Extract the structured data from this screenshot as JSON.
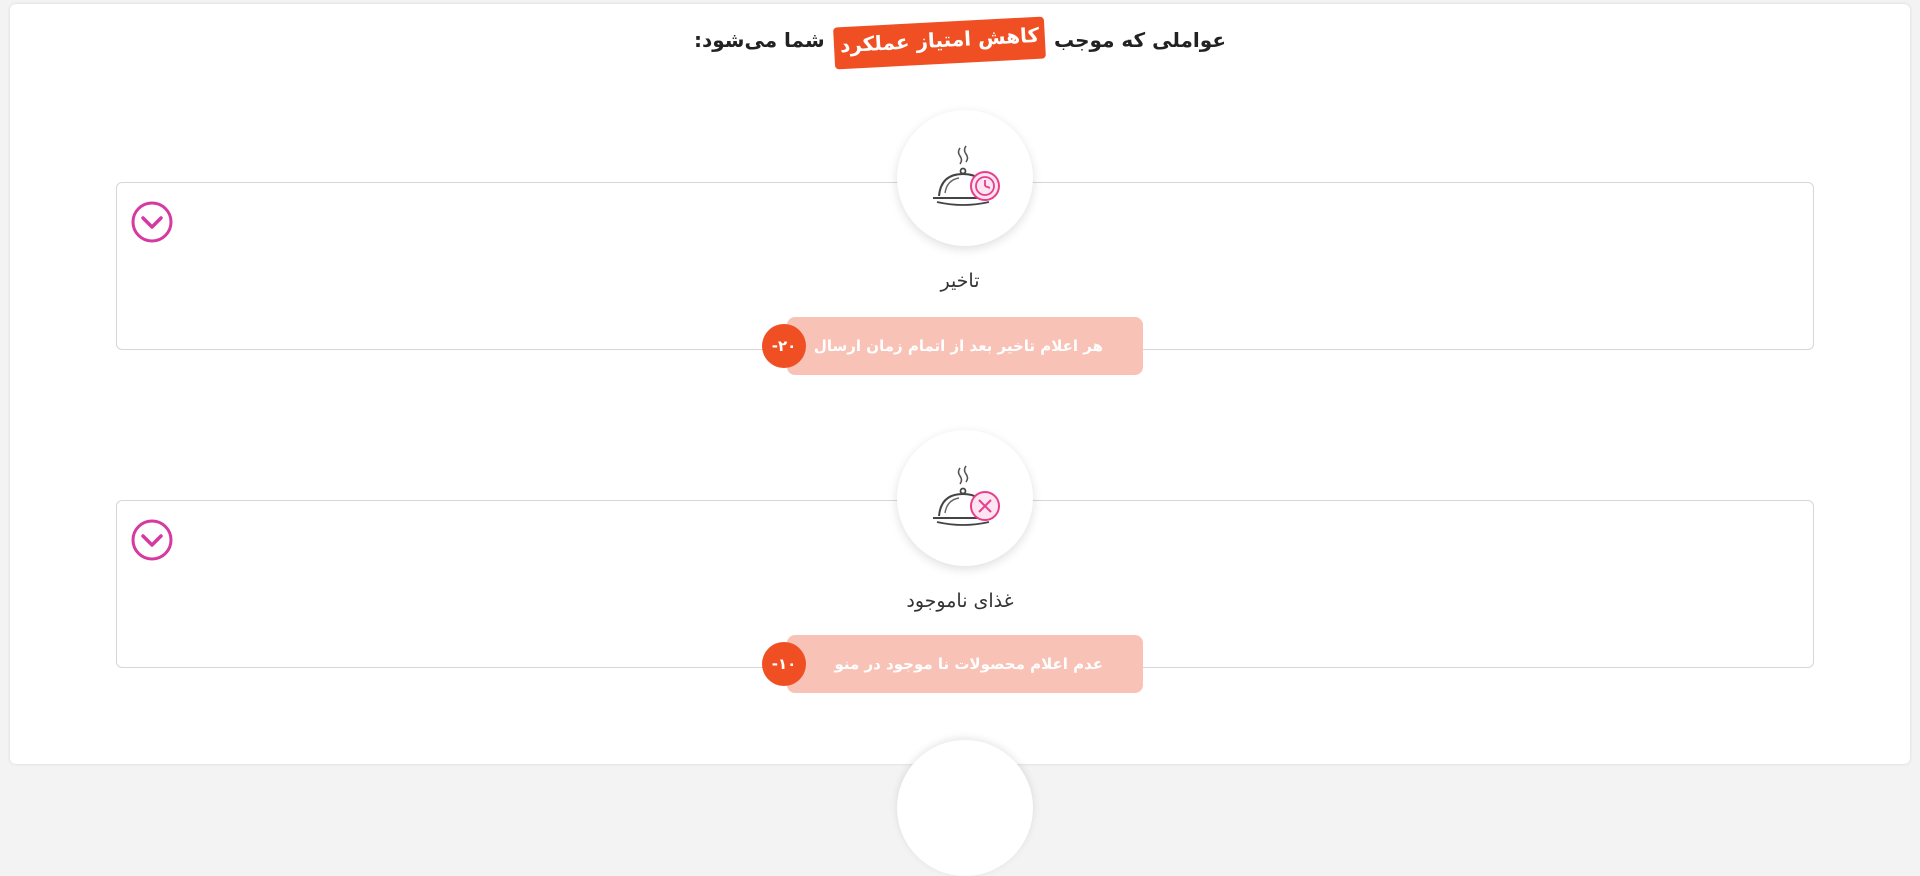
{
  "header": {
    "text_before": "عواملی که موجب",
    "highlight": "کاهش امتیاز عملکرد",
    "text_after": "شما می‌شود:"
  },
  "colors": {
    "accent": "#f04e23",
    "pill_bg": "#f9c2b7",
    "toggle": "#d63aa0",
    "icon_badge": "#e83e8c"
  },
  "factors": [
    {
      "title": "تاخیر",
      "description": "هر اعلام تاخیر بعد از اتمام زمان ارسال",
      "penalty": "-۲۰",
      "icon": "food-cloche-clock-icon"
    },
    {
      "title": "غذای ناموجود",
      "description": "عدم اعلام محصولات نا موجود در منو",
      "penalty": "-۱۰",
      "icon": "food-cloche-x-icon"
    }
  ]
}
